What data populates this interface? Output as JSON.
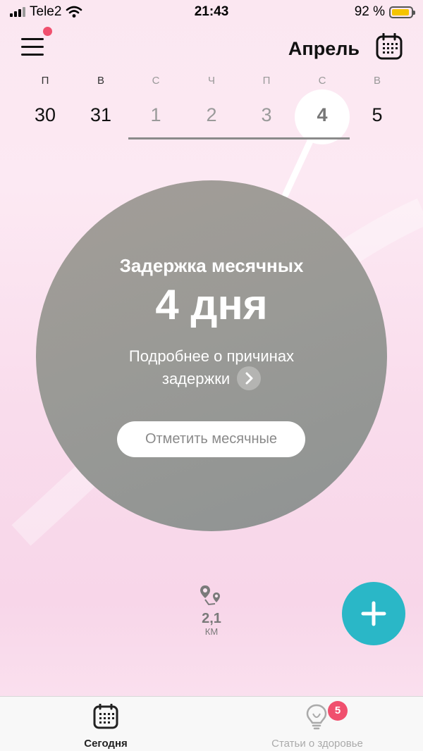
{
  "status_bar": {
    "carrier": "Tele2",
    "time": "21:43",
    "battery": "92 %",
    "battery_level": 0.92,
    "icons": [
      "signal-icon",
      "wifi-icon",
      "battery-icon"
    ]
  },
  "header": {
    "month": "Апрель",
    "menu_icon": "hamburger-menu-icon",
    "calendar_icon": "calendar-icon",
    "notification_dot_color": "#f0506e"
  },
  "week": {
    "days": [
      {
        "weekday": "П",
        "number": "30"
      },
      {
        "weekday": "В",
        "number": "31"
      },
      {
        "weekday": "С",
        "number": "1"
      },
      {
        "weekday": "Ч",
        "number": "2"
      },
      {
        "weekday": "П",
        "number": "3"
      },
      {
        "weekday": "С",
        "number": "4"
      },
      {
        "weekday": "В",
        "number": "5"
      }
    ],
    "selected_number": "4"
  },
  "cycle": {
    "title": "Задержка месячных",
    "value": "4 дня",
    "link_line1": "Подробнее о причинах",
    "link_line2": "задержки",
    "button": "Отметить месячные"
  },
  "distance": {
    "value": "2,1",
    "unit": "КМ",
    "icon": "route-pins-icon"
  },
  "fab": {
    "icon": "plus-icon",
    "color": "#2ab7c7"
  },
  "tabs": [
    {
      "label": "Сегодня",
      "icon": "calendar-icon",
      "active": true
    },
    {
      "label": "Статьи о здоровье",
      "icon": "lightbulb-icon",
      "active": false,
      "badge": "5"
    }
  ]
}
